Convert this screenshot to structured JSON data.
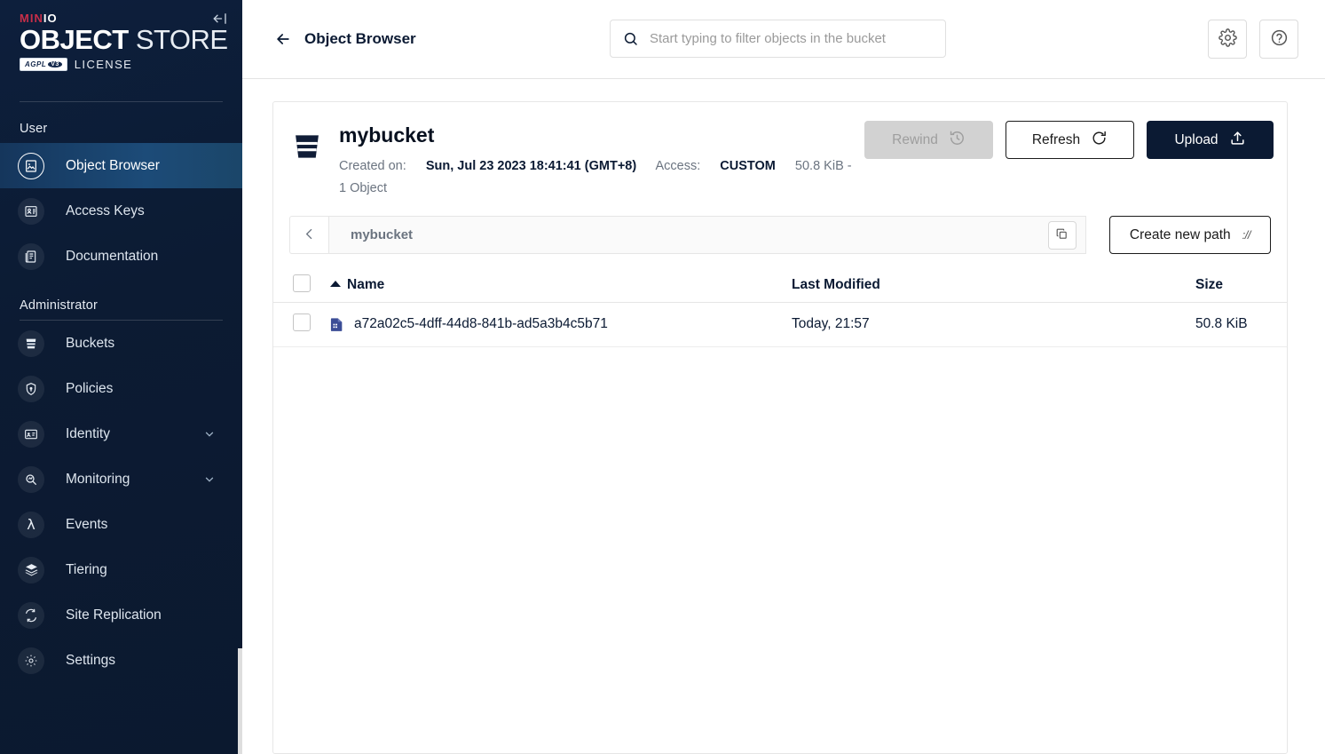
{
  "sidebar": {
    "logo": {
      "brand_prefix": "MIN",
      "brand_suffix": "IO",
      "title_bold": "OBJECT",
      "title_light": "STORE",
      "license_badge": "AGPL",
      "license_badge_version": "V3",
      "license_text": "LICENSE"
    },
    "collapse_icon": "collapse-left-icon",
    "sections": [
      {
        "label": "User",
        "items": [
          {
            "label": "Object Browser",
            "icon": "object-browser-icon",
            "active": true,
            "expandable": false
          },
          {
            "label": "Access Keys",
            "icon": "access-keys-icon",
            "active": false,
            "expandable": false
          },
          {
            "label": "Documentation",
            "icon": "documentation-icon",
            "active": false,
            "expandable": false
          }
        ]
      },
      {
        "label": "Administrator",
        "items": [
          {
            "label": "Buckets",
            "icon": "bucket-icon",
            "active": false,
            "expandable": false
          },
          {
            "label": "Policies",
            "icon": "policy-lock-icon",
            "active": false,
            "expandable": false
          },
          {
            "label": "Identity",
            "icon": "identity-card-icon",
            "active": false,
            "expandable": true
          },
          {
            "label": "Monitoring",
            "icon": "monitoring-icon",
            "active": false,
            "expandable": true
          },
          {
            "label": "Events",
            "icon": "lambda-icon",
            "active": false,
            "expandable": false
          },
          {
            "label": "Tiering",
            "icon": "layers-icon",
            "active": false,
            "expandable": false
          },
          {
            "label": "Site Replication",
            "icon": "replication-icon",
            "active": false,
            "expandable": false
          },
          {
            "label": "Settings",
            "icon": "gear-icon",
            "active": false,
            "expandable": false
          }
        ]
      }
    ]
  },
  "topbar": {
    "back_icon": "arrow-left-icon",
    "title": "Object Browser",
    "search": {
      "icon": "search-icon",
      "placeholder": "Start typing to filter objects in the bucket",
      "value": ""
    },
    "actions": [
      {
        "name": "settings-button",
        "icon": "gear-icon"
      },
      {
        "name": "help-button",
        "icon": "help-circle-icon"
      }
    ]
  },
  "bucket": {
    "icon": "bucket-icon",
    "name": "mybucket",
    "created_label": "Created on:",
    "created_value": "Sun, Jul 23 2023 18:41:41 (GMT+8)",
    "access_label": "Access:",
    "access_value": "CUSTOM",
    "size_and_objects": "50.8 KiB - 1 Object",
    "actions": {
      "rewind": {
        "label": "Rewind",
        "icon": "rewind-clock-icon",
        "disabled": true
      },
      "refresh": {
        "label": "Refresh",
        "icon": "refresh-icon",
        "disabled": false
      },
      "upload": {
        "label": "Upload",
        "icon": "upload-icon",
        "disabled": false
      }
    }
  },
  "path_bar": {
    "back_icon": "chevron-left-icon",
    "path": "mybucket",
    "copy_icon": "copy-icon",
    "create_path_label": "Create new path",
    "create_path_icon": "protocol-slash-icon"
  },
  "table": {
    "columns": {
      "name": "Name",
      "last_modified": "Last Modified",
      "size": "Size"
    },
    "sort": {
      "column": "name",
      "direction": "asc"
    },
    "select_all_checked": false,
    "rows": [
      {
        "checked": false,
        "icon": "file-document-icon",
        "name": "a72a02c5-4dff-44d8-841b-ad5a3b4c5b71",
        "last_modified": "Today, 21:57",
        "size": "50.8 KiB"
      }
    ]
  },
  "colors": {
    "sidebar_bg": "#0c1b33",
    "sidebar_active": "#1c4b78",
    "brand_red": "#c72e49",
    "primary_dark": "#0b1a33",
    "text_muted": "#6b7480",
    "border": "#e6e6e6",
    "disabled_bg": "#d2d2d2",
    "file_icon_blue": "#3b4d96"
  }
}
